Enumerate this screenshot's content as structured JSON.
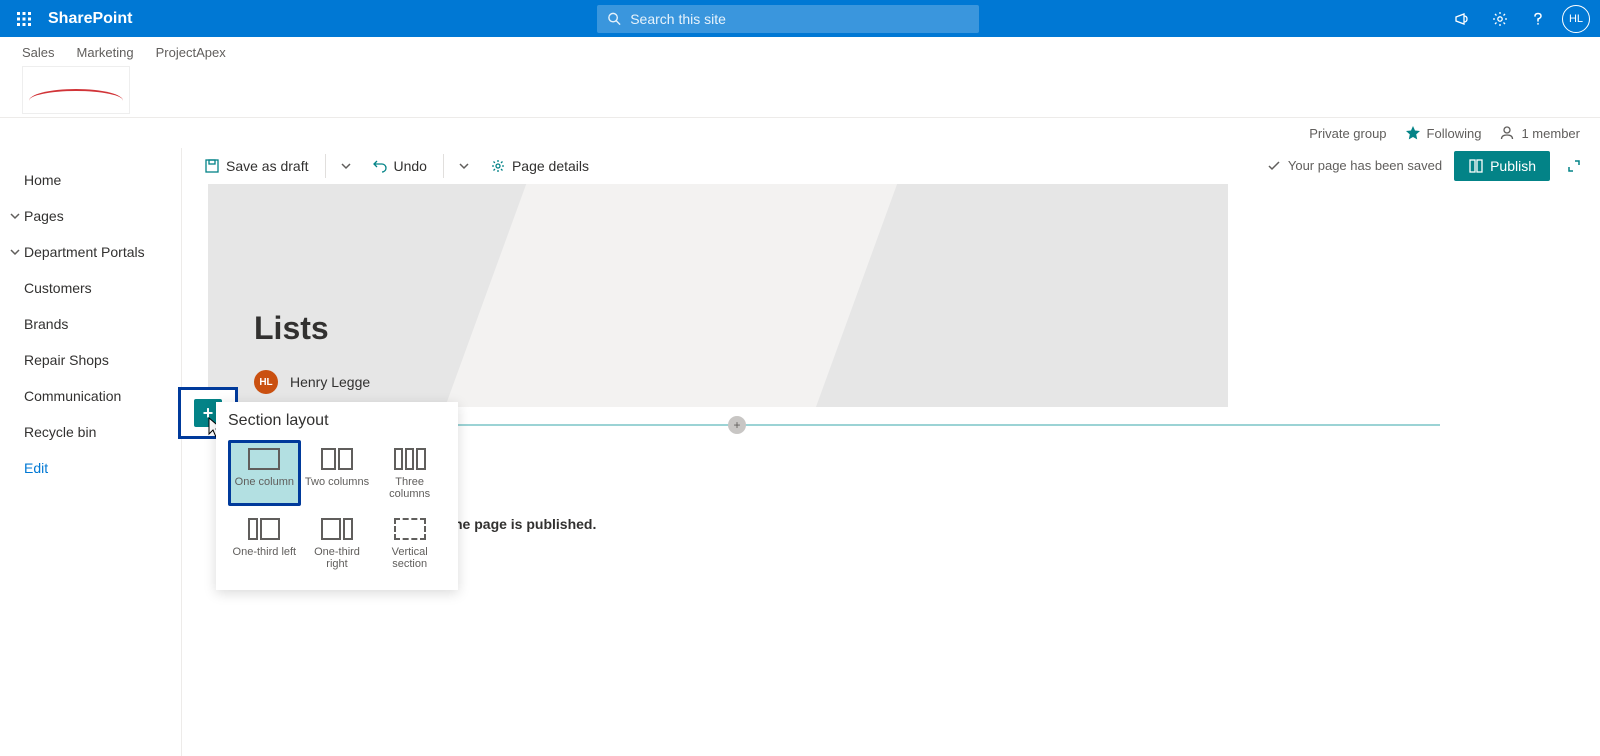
{
  "app": {
    "name": "SharePoint"
  },
  "search": {
    "placeholder": "Search this site"
  },
  "suite": {
    "me_initials": "HL"
  },
  "hub_links": [
    "Sales",
    "Marketing",
    "ProjectApex"
  ],
  "site_info": {
    "privacy": "Private group",
    "following_label": "Following",
    "members_label": "1 member"
  },
  "leftnav": {
    "items": [
      {
        "label": "Home",
        "chev": false
      },
      {
        "label": "Pages",
        "chev": true
      },
      {
        "label": "Department Portals",
        "chev": true
      },
      {
        "label": "Customers",
        "chev": false
      },
      {
        "label": "Brands",
        "chev": false
      },
      {
        "label": "Repair Shops",
        "chev": false
      },
      {
        "label": "Communication",
        "chev": false
      },
      {
        "label": "Recycle bin",
        "chev": false
      }
    ],
    "edit_label": "Edit"
  },
  "cmdbar": {
    "save_draft": "Save as draft",
    "undo": "Undo",
    "page_details": "Page details",
    "saved_msg": "Your page has been saved",
    "publish": "Publish"
  },
  "page": {
    "title": "Lists",
    "author_initials": "HL",
    "author_name": "Henry Legge",
    "hint_suffix_plain": "he page is published."
  },
  "section_layout": {
    "title": "Section layout",
    "options": [
      {
        "label": "One column"
      },
      {
        "label": "Two columns"
      },
      {
        "label": "Three columns"
      },
      {
        "label": "One-third left"
      },
      {
        "label": "One-third right"
      },
      {
        "label": "Vertical section"
      }
    ]
  }
}
